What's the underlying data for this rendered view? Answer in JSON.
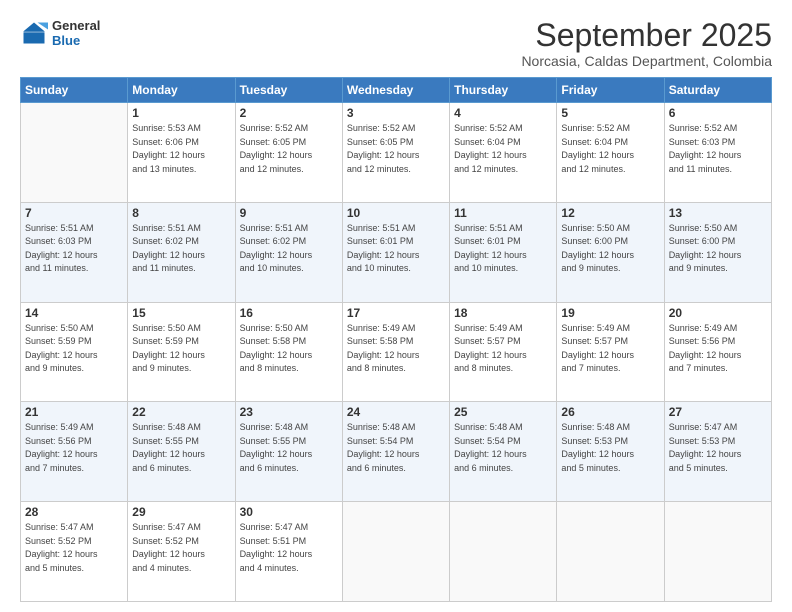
{
  "logo": {
    "line1": "General",
    "line2": "Blue"
  },
  "header": {
    "title": "September 2025",
    "subtitle": "Norcasia, Caldas Department, Colombia"
  },
  "weekdays": [
    "Sunday",
    "Monday",
    "Tuesday",
    "Wednesday",
    "Thursday",
    "Friday",
    "Saturday"
  ],
  "weeks": [
    [
      {
        "day": "",
        "info": ""
      },
      {
        "day": "1",
        "info": "Sunrise: 5:53 AM\nSunset: 6:06 PM\nDaylight: 12 hours\nand 13 minutes."
      },
      {
        "day": "2",
        "info": "Sunrise: 5:52 AM\nSunset: 6:05 PM\nDaylight: 12 hours\nand 12 minutes."
      },
      {
        "day": "3",
        "info": "Sunrise: 5:52 AM\nSunset: 6:05 PM\nDaylight: 12 hours\nand 12 minutes."
      },
      {
        "day": "4",
        "info": "Sunrise: 5:52 AM\nSunset: 6:04 PM\nDaylight: 12 hours\nand 12 minutes."
      },
      {
        "day": "5",
        "info": "Sunrise: 5:52 AM\nSunset: 6:04 PM\nDaylight: 12 hours\nand 12 minutes."
      },
      {
        "day": "6",
        "info": "Sunrise: 5:52 AM\nSunset: 6:03 PM\nDaylight: 12 hours\nand 11 minutes."
      }
    ],
    [
      {
        "day": "7",
        "info": "Sunrise: 5:51 AM\nSunset: 6:03 PM\nDaylight: 12 hours\nand 11 minutes."
      },
      {
        "day": "8",
        "info": "Sunrise: 5:51 AM\nSunset: 6:02 PM\nDaylight: 12 hours\nand 11 minutes."
      },
      {
        "day": "9",
        "info": "Sunrise: 5:51 AM\nSunset: 6:02 PM\nDaylight: 12 hours\nand 10 minutes."
      },
      {
        "day": "10",
        "info": "Sunrise: 5:51 AM\nSunset: 6:01 PM\nDaylight: 12 hours\nand 10 minutes."
      },
      {
        "day": "11",
        "info": "Sunrise: 5:51 AM\nSunset: 6:01 PM\nDaylight: 12 hours\nand 10 minutes."
      },
      {
        "day": "12",
        "info": "Sunrise: 5:50 AM\nSunset: 6:00 PM\nDaylight: 12 hours\nand 9 minutes."
      },
      {
        "day": "13",
        "info": "Sunrise: 5:50 AM\nSunset: 6:00 PM\nDaylight: 12 hours\nand 9 minutes."
      }
    ],
    [
      {
        "day": "14",
        "info": "Sunrise: 5:50 AM\nSunset: 5:59 PM\nDaylight: 12 hours\nand 9 minutes."
      },
      {
        "day": "15",
        "info": "Sunrise: 5:50 AM\nSunset: 5:59 PM\nDaylight: 12 hours\nand 9 minutes."
      },
      {
        "day": "16",
        "info": "Sunrise: 5:50 AM\nSunset: 5:58 PM\nDaylight: 12 hours\nand 8 minutes."
      },
      {
        "day": "17",
        "info": "Sunrise: 5:49 AM\nSunset: 5:58 PM\nDaylight: 12 hours\nand 8 minutes."
      },
      {
        "day": "18",
        "info": "Sunrise: 5:49 AM\nSunset: 5:57 PM\nDaylight: 12 hours\nand 8 minutes."
      },
      {
        "day": "19",
        "info": "Sunrise: 5:49 AM\nSunset: 5:57 PM\nDaylight: 12 hours\nand 7 minutes."
      },
      {
        "day": "20",
        "info": "Sunrise: 5:49 AM\nSunset: 5:56 PM\nDaylight: 12 hours\nand 7 minutes."
      }
    ],
    [
      {
        "day": "21",
        "info": "Sunrise: 5:49 AM\nSunset: 5:56 PM\nDaylight: 12 hours\nand 7 minutes."
      },
      {
        "day": "22",
        "info": "Sunrise: 5:48 AM\nSunset: 5:55 PM\nDaylight: 12 hours\nand 6 minutes."
      },
      {
        "day": "23",
        "info": "Sunrise: 5:48 AM\nSunset: 5:55 PM\nDaylight: 12 hours\nand 6 minutes."
      },
      {
        "day": "24",
        "info": "Sunrise: 5:48 AM\nSunset: 5:54 PM\nDaylight: 12 hours\nand 6 minutes."
      },
      {
        "day": "25",
        "info": "Sunrise: 5:48 AM\nSunset: 5:54 PM\nDaylight: 12 hours\nand 6 minutes."
      },
      {
        "day": "26",
        "info": "Sunrise: 5:48 AM\nSunset: 5:53 PM\nDaylight: 12 hours\nand 5 minutes."
      },
      {
        "day": "27",
        "info": "Sunrise: 5:47 AM\nSunset: 5:53 PM\nDaylight: 12 hours\nand 5 minutes."
      }
    ],
    [
      {
        "day": "28",
        "info": "Sunrise: 5:47 AM\nSunset: 5:52 PM\nDaylight: 12 hours\nand 5 minutes."
      },
      {
        "day": "29",
        "info": "Sunrise: 5:47 AM\nSunset: 5:52 PM\nDaylight: 12 hours\nand 4 minutes."
      },
      {
        "day": "30",
        "info": "Sunrise: 5:47 AM\nSunset: 5:51 PM\nDaylight: 12 hours\nand 4 minutes."
      },
      {
        "day": "",
        "info": ""
      },
      {
        "day": "",
        "info": ""
      },
      {
        "day": "",
        "info": ""
      },
      {
        "day": "",
        "info": ""
      }
    ]
  ]
}
